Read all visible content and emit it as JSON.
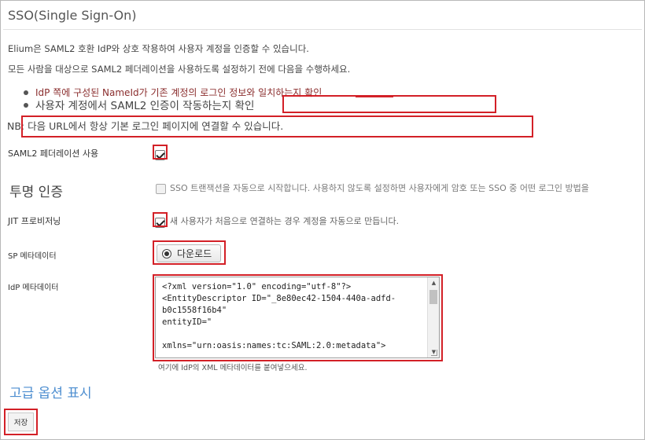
{
  "page": {
    "title": "SSO(Single Sign-On)",
    "intro": "Elium은 SAML2 호환 IdP와 상호 작용하여 사용자 계정을 인증할 수 있습니다.",
    "before": "모든 사람을 대상으로 SAML2 페더레이션을 사용하도록 설정하기 전에 다음을 수행하세요.",
    "bullets": [
      "IdP 쪽에 구성된 NameId가 기존 계정의 로그인 정보와 일치하는지 확인",
      "사용자 계정에서 SAML2 인증이 작동하는지 확인"
    ],
    "nb": "NB: 다음 URL에서 항상 기본 로그인 페이지에 연결할 수 있습니다."
  },
  "form": {
    "saml2_label": "SAML2 페더레이션 사용",
    "saml2_checked": true,
    "transparent_heading": "투명 인증",
    "transparent_desc": "SSO 트랜잭션을 자동으로 시작합니다. 사용하지 않도록 설정하면 사용자에게 암호 또는 SSO 중 어떤 로그인 방법을",
    "transparent_checked": false,
    "jit_label": "JIT 프로비저닝",
    "jit_desc": "새 사용자가 처음으로 연결하는 경우 계정을 자동으로 만듭니다.",
    "jit_checked": true,
    "sp_label": "SP 메타데이터",
    "download_label": "다운로드",
    "idp_label": "IdP 메타데이터",
    "idp_xml": "<?xml version=\"1.0\" encoding=\"utf-8\"?>\n<EntityDescriptor ID=\"_8e80ec42-1504-440a-adfd-\nb0c1558f16b4\"\nentityID=\"\n\nxmlns=\"urn:oasis:names:tc:SAML:2.0:metadata\">",
    "idp_help": "여기에 IdP의 XML 메타데이터를 붙여넣으세요.",
    "advanced_link": "고급 옵션 표시",
    "save_label": "저장"
  },
  "colors": {
    "highlight": "#d32027",
    "link": "#4d8ed0",
    "bullet_text": "#8a2d2d"
  }
}
